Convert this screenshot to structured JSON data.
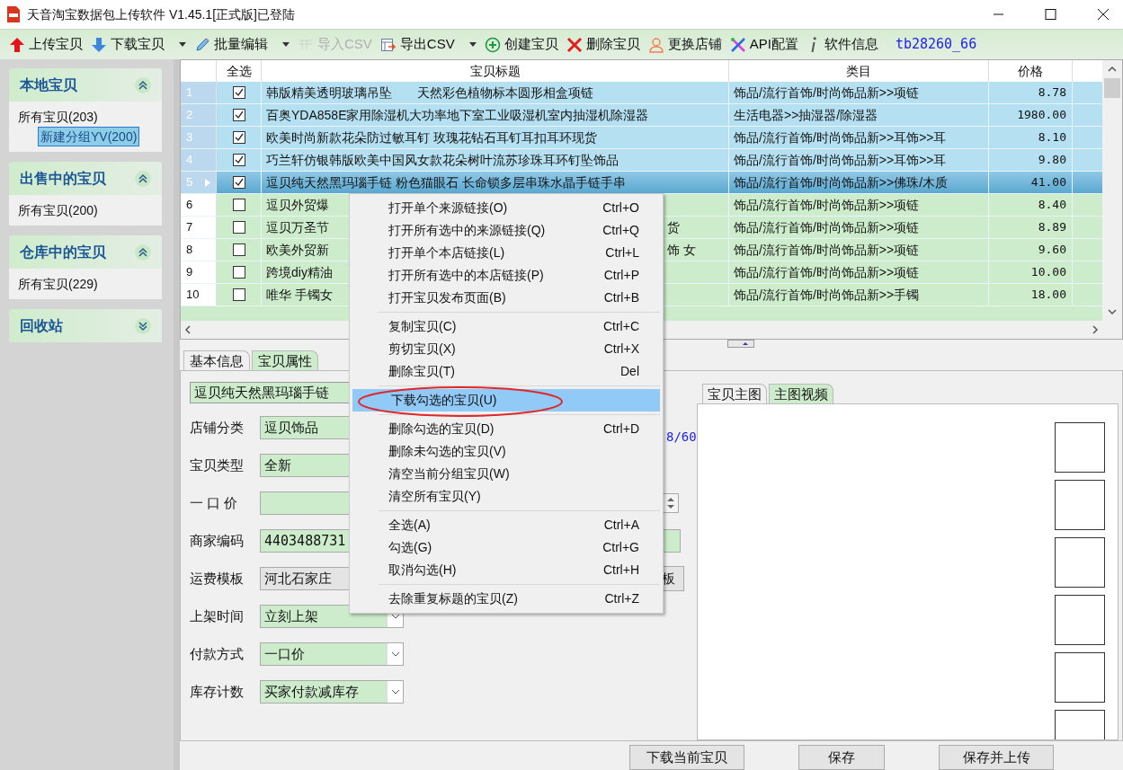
{
  "window": {
    "title": "天音淘宝数据包上传软件 V1.45.1[正式版]已登陆"
  },
  "toolbar": {
    "items": [
      {
        "kind": "upload",
        "label": "上传宝贝",
        "dropdown": false,
        "disabled": false
      },
      {
        "kind": "download",
        "label": "下载宝贝",
        "dropdown": true,
        "disabled": false
      },
      {
        "kind": "edit",
        "label": "批量编辑",
        "dropdown": true,
        "disabled": false
      },
      {
        "kind": "import",
        "label": "导入CSV",
        "dropdown": false,
        "disabled": true
      },
      {
        "kind": "export",
        "label": "导出CSV",
        "dropdown": true,
        "disabled": false
      },
      {
        "kind": "create",
        "label": "创建宝贝",
        "dropdown": false,
        "disabled": false
      },
      {
        "kind": "delete",
        "label": "删除宝贝",
        "dropdown": false,
        "disabled": false
      },
      {
        "kind": "shop",
        "label": "更换店铺",
        "dropdown": false,
        "disabled": false
      },
      {
        "kind": "api",
        "label": "API配置",
        "dropdown": false,
        "disabled": false
      },
      {
        "kind": "info",
        "label": "软件信息",
        "dropdown": false,
        "disabled": false
      }
    ],
    "account": "tb28260_66"
  },
  "sidebar": {
    "sections": [
      {
        "title": "本地宝贝",
        "expanded": true,
        "items": [
          {
            "label": "所有宝贝(203)",
            "selected": false,
            "children": [
              {
                "label": "新建分组YV(200)",
                "selected": true
              }
            ]
          }
        ]
      },
      {
        "title": "出售中的宝贝",
        "expanded": true,
        "items": [
          {
            "label": "所有宝贝(200)",
            "selected": false
          }
        ]
      },
      {
        "title": "仓库中的宝贝",
        "expanded": true,
        "items": [
          {
            "label": "所有宝贝(229)",
            "selected": false
          }
        ]
      },
      {
        "title": "回收站",
        "expanded": false
      }
    ]
  },
  "table": {
    "columns": [
      "全选",
      "宝贝标题",
      "类目",
      "价格"
    ],
    "rows": [
      {
        "num": "1",
        "checked": true,
        "selected": false,
        "title": "韩版精美透明玻璃吊坠　　天然彩色植物标本圆形相盒项链",
        "category": "饰品/流行首饰/时尚饰品新>>项链",
        "price": "8.78"
      },
      {
        "num": "2",
        "checked": true,
        "selected": false,
        "title": "百奥YDA858E家用除湿机大功率地下室工业吸湿机室内抽湿机除湿器",
        "category": "生活电器>>抽湿器/除湿器",
        "price": "1980.00"
      },
      {
        "num": "3",
        "checked": true,
        "selected": false,
        "title": "欧美时尚新款花朵防过敏耳钉 玫瑰花钻石耳钉耳扣耳环现货",
        "category": "饰品/流行首饰/时尚饰品新>>耳饰>>耳",
        "price": "8.10"
      },
      {
        "num": "4",
        "checked": true,
        "selected": false,
        "title": "巧兰轩仿银韩版欧美中国风女款花朵树叶流苏珍珠耳环钉坠饰品",
        "category": "饰品/流行首饰/时尚饰品新>>耳饰>>耳",
        "price": "9.80"
      },
      {
        "num": "5",
        "checked": true,
        "selected": true,
        "title": "逗贝纯天然黑玛瑙手链 粉色猫眼石 长命锁多层串珠水晶手链手串",
        "category": "饰品/流行首饰/时尚饰品新>>佛珠/木质",
        "price": "41.00"
      },
      {
        "num": "6",
        "checked": false,
        "selected": false,
        "title": "逗贝外贸爆",
        "category": "饰品/流行首饰/时尚饰品新>>项链",
        "price": "8.40"
      },
      {
        "num": "7",
        "checked": false,
        "selected": false,
        "title": "逗贝万圣节",
        "title_tail": "货",
        "category": "饰品/流行首饰/时尚饰品新>>项链",
        "price": "8.89"
      },
      {
        "num": "8",
        "checked": false,
        "selected": false,
        "title": "欧美外贸新",
        "title_tail": "饰 女",
        "category": "饰品/流行首饰/时尚饰品新>>项链",
        "price": "9.60"
      },
      {
        "num": "9",
        "checked": false,
        "selected": false,
        "title": "跨境diy精油",
        "category": "饰品/流行首饰/时尚饰品新>>项链",
        "price": "10.00"
      },
      {
        "num": "10",
        "checked": false,
        "selected": false,
        "title": "唯华 手镯女",
        "category": "饰品/流行首饰/时尚饰品新>>手镯",
        "price": "18.00"
      }
    ]
  },
  "detail_tabs": [
    {
      "label": "基本信息",
      "selected": true
    },
    {
      "label": "宝贝属性",
      "selected": false
    }
  ],
  "form": {
    "title_value": "逗贝纯天然黑玛瑙手链",
    "title_count": "8/60",
    "fields": [
      {
        "label": "店铺分类",
        "value": "逗贝饰品",
        "kind": "text"
      },
      {
        "label": "宝贝类型",
        "value": "全新",
        "kind": "text"
      },
      {
        "label": "一 口 价",
        "kind": "spin"
      },
      {
        "label": "商家编码",
        "value": "4403488731",
        "kind": "wide"
      },
      {
        "label": "运费模板",
        "value": "河北石家庄",
        "kind": "button",
        "button": "板"
      },
      {
        "label": "上架时间",
        "value": "立刻上架",
        "kind": "combo"
      },
      {
        "label": "付款方式",
        "value": "一口价",
        "kind": "combo"
      },
      {
        "label": "库存计数",
        "value": "买家付款减库存",
        "kind": "combo"
      }
    ]
  },
  "image_tabs": [
    {
      "label": "宝贝主图",
      "selected": true
    },
    {
      "label": "主图视频",
      "selected": false
    }
  ],
  "buttons": [
    "下载当前宝贝",
    "保存",
    "保存并上传"
  ],
  "context_menu": {
    "items": [
      {
        "kind": "item",
        "label": "打开单个来源链接(O)",
        "shortcut": "Ctrl+O",
        "selected": false
      },
      {
        "kind": "item",
        "label": "打开所有选中的来源链接(Q)",
        "shortcut": "Ctrl+Q",
        "selected": false
      },
      {
        "kind": "item",
        "label": "打开单个本店链接(L)",
        "shortcut": "Ctrl+L",
        "selected": false
      },
      {
        "kind": "item",
        "label": "打开所有选中的本店链接(P)",
        "shortcut": "Ctrl+P",
        "selected": false
      },
      {
        "kind": "item",
        "label": "打开宝贝发布页面(B)",
        "shortcut": "Ctrl+B",
        "selected": false
      },
      {
        "kind": "separator"
      },
      {
        "kind": "item",
        "label": "复制宝贝(C)",
        "shortcut": "Ctrl+C",
        "selected": false
      },
      {
        "kind": "item",
        "label": "剪切宝贝(X)",
        "shortcut": "Ctrl+X",
        "selected": false
      },
      {
        "kind": "item",
        "label": "删除宝贝(T)",
        "shortcut": "Del",
        "selected": false
      },
      {
        "kind": "separator"
      },
      {
        "kind": "item",
        "label": "下载勾选的宝贝(U)",
        "selected": true
      },
      {
        "kind": "separator"
      },
      {
        "kind": "item",
        "label": "删除勾选的宝贝(D)",
        "shortcut": "Ctrl+D",
        "selected": false
      },
      {
        "kind": "item",
        "label": "删除未勾选的宝贝(V)",
        "selected": false
      },
      {
        "kind": "item",
        "label": "清空当前分组宝贝(W)",
        "selected": false
      },
      {
        "kind": "item",
        "label": "清空所有宝贝(Y)",
        "selected": false
      },
      {
        "kind": "separator"
      },
      {
        "kind": "item",
        "label": "全选(A)",
        "shortcut": "Ctrl+A",
        "selected": false
      },
      {
        "kind": "item",
        "label": "勾选(G)",
        "shortcut": "Ctrl+G",
        "selected": false
      },
      {
        "kind": "item",
        "label": "取消勾选(H)",
        "shortcut": "Ctrl+H",
        "selected": false
      },
      {
        "kind": "separator"
      },
      {
        "kind": "item",
        "label": "去除重复标题的宝贝(Z)",
        "shortcut": "Ctrl+Z",
        "selected": false
      }
    ]
  }
}
